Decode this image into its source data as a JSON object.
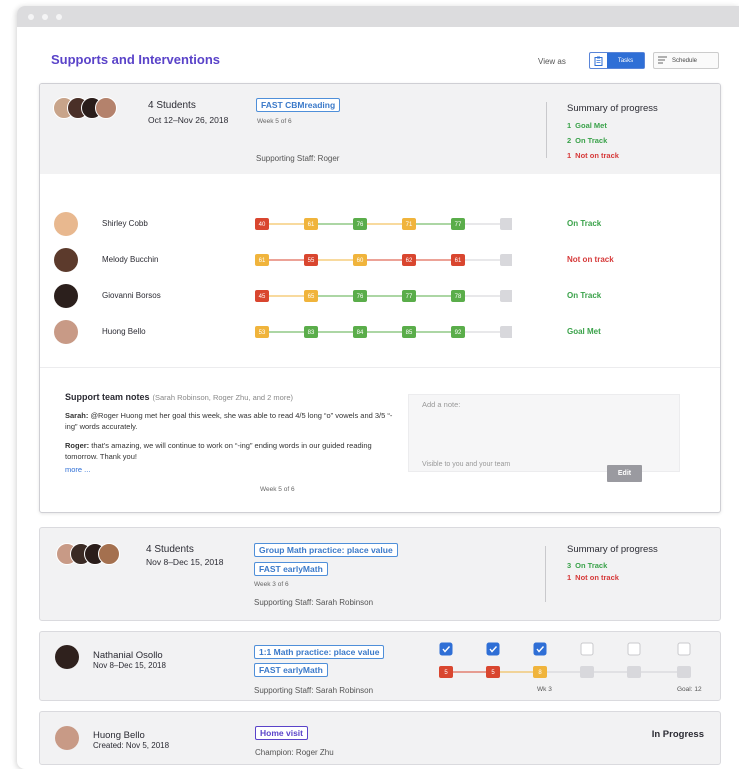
{
  "page": {
    "title": "Supports and Interventions",
    "view_as_label": "View as",
    "tasks_label": "Tasks",
    "schedule_label": "Schedule"
  },
  "group1": {
    "students_count": "4 Students",
    "date_range": "Oct 12–Nov 26, 2018",
    "intervention": "FAST CBMreading",
    "week": "Week 5 of 6",
    "supporting_staff": "Supporting Staff: Roger",
    "summary_title": "Summary of progress",
    "summary": [
      {
        "count": "1",
        "label": "Goal Met",
        "color": "#3aa24a"
      },
      {
        "count": "2",
        "label": "On Track",
        "color": "#3aa24a"
      },
      {
        "count": "1",
        "label": "Not on track",
        "color": "#d63a3a"
      }
    ],
    "students": [
      {
        "name": "Shirley Cobb",
        "status": "On Track",
        "status_color": "#3aa24a",
        "avatar_color": "#e8b88f",
        "scores": [
          {
            "v": "40",
            "c": "#d9462f"
          },
          {
            "v": "61",
            "c": "#f0b43c"
          },
          {
            "v": "76",
            "c": "#5aad4a"
          },
          {
            "v": "71",
            "c": "#f0b43c"
          },
          {
            "v": "77",
            "c": "#5aad4a"
          }
        ]
      },
      {
        "name": "Melody Bucchin",
        "status": "Not on track",
        "status_color": "#d63a3a",
        "avatar_color": "#5c3a2c",
        "scores": [
          {
            "v": "61",
            "c": "#f0b43c"
          },
          {
            "v": "55",
            "c": "#d9462f"
          },
          {
            "v": "60",
            "c": "#f0b43c"
          },
          {
            "v": "62",
            "c": "#d9462f"
          },
          {
            "v": "61",
            "c": "#d9462f"
          }
        ]
      },
      {
        "name": "Giovanni Borsos",
        "status": "On Track",
        "status_color": "#3aa24a",
        "avatar_color": "#2b1f1c",
        "scores": [
          {
            "v": "45",
            "c": "#d9462f"
          },
          {
            "v": "65",
            "c": "#f0b43c"
          },
          {
            "v": "76",
            "c": "#5aad4a"
          },
          {
            "v": "77",
            "c": "#5aad4a"
          },
          {
            "v": "78",
            "c": "#5aad4a"
          }
        ]
      },
      {
        "name": "Huong Bello",
        "status": "Goal Met",
        "status_color": "#3aa24a",
        "avatar_color": "#c89a86",
        "scores": [
          {
            "v": "53",
            "c": "#f0b43c"
          },
          {
            "v": "83",
            "c": "#5aad4a"
          },
          {
            "v": "84",
            "c": "#5aad4a"
          },
          {
            "v": "85",
            "c": "#5aad4a"
          },
          {
            "v": "92",
            "c": "#5aad4a"
          }
        ]
      }
    ],
    "notes_title": "Support team notes",
    "notes_participants": "(Sarah Robinson, Roger Zhu, and 2 more)",
    "notes": [
      {
        "author": "Sarah:",
        "text": "@Roger Huong met her goal this week, she was able to read 4/5 long “o” vowels and 3/5 “-ing” words accurately."
      },
      {
        "author": "Roger:",
        "text": "that’s amazing, we will continue to work on “-ing” ending words in our guided reading tomorrow. Thank you!"
      }
    ],
    "more_link": "more ...",
    "add_note_placeholder": "Add a note:",
    "visibility": "Visible to you and your team",
    "edit_label": "Edit",
    "footer_week": "Week 5 of 6"
  },
  "group2": {
    "students_count": "4 Students",
    "date_range": "Nov 8–Dec 15, 2018",
    "interventions": [
      "Group Math practice: place value",
      "FAST earlyMath"
    ],
    "week": "Week 3 of 6",
    "supporting_staff": "Supporting Staff: Sarah Robinson",
    "summary_title": "Summary of progress",
    "summary": [
      {
        "count": "3",
        "label": "On Track",
        "color": "#3aa24a"
      },
      {
        "count": "1",
        "label": "Not on track",
        "color": "#d63a3a"
      }
    ]
  },
  "group3": {
    "name": "Nathanial Osollo",
    "date_range": "Nov 8–Dec 15, 2018",
    "interventions": [
      "1:1 Math practice: place value",
      "FAST earlyMath"
    ],
    "supporting_staff": "Supporting Staff: Sarah Robinson",
    "checks": [
      true,
      true,
      true,
      false,
      false,
      false
    ],
    "scores": [
      {
        "v": "5",
        "c": "#d9462f"
      },
      {
        "v": "5",
        "c": "#d9462f"
      },
      {
        "v": "8",
        "c": "#f0b43c"
      }
    ],
    "week_label": "Wk 3",
    "goal_label": "Goal: 12"
  },
  "group4": {
    "name": "Huong Bello",
    "created": "Created: Nov 5, 2018",
    "intervention": "Home visit",
    "champion": "Champion: Roger Zhu",
    "status": "In Progress"
  }
}
